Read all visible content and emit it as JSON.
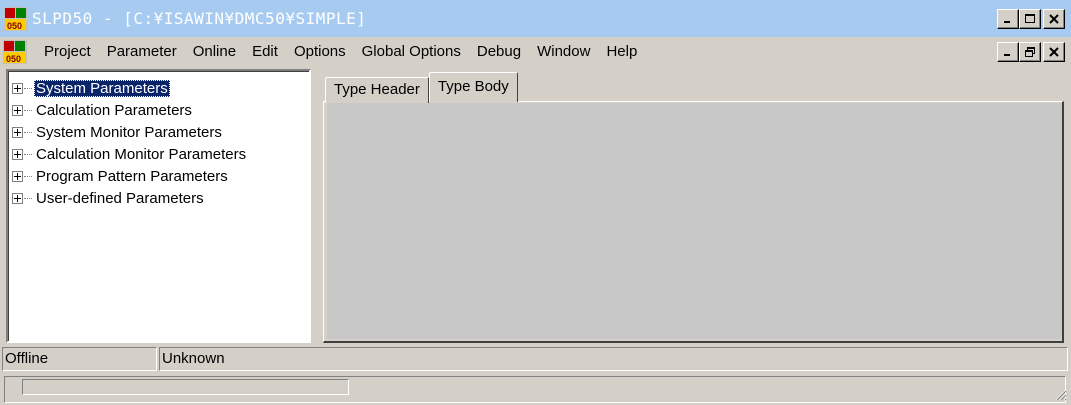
{
  "window": {
    "title": "SLPD50 - [C:¥ISAWIN¥DMC50¥SIMPLE]",
    "app_icon": "slpd50-app-icon",
    "controls": [
      "minimize-icon",
      "maximize-icon",
      "close-icon"
    ]
  },
  "menubar": {
    "doc_icon": "slpd50-doc-icon",
    "items": [
      {
        "label": "Project"
      },
      {
        "label": "Parameter"
      },
      {
        "label": "Online"
      },
      {
        "label": "Edit"
      },
      {
        "label": "Options"
      },
      {
        "label": "Global Options"
      },
      {
        "label": "Debug"
      },
      {
        "label": "Window"
      },
      {
        "label": "Help"
      }
    ],
    "mdi_controls": [
      "minimize-icon",
      "restore-icon",
      "close-icon"
    ]
  },
  "tree": {
    "items": [
      {
        "label": "System Parameters",
        "selected": true
      },
      {
        "label": "Calculation Parameters"
      },
      {
        "label": "System Monitor Parameters"
      },
      {
        "label": "Calculation Monitor Parameters"
      },
      {
        "label": "Program Pattern Parameters"
      },
      {
        "label": "User-defined Parameters"
      }
    ]
  },
  "tabs": [
    {
      "label": "Type Header"
    },
    {
      "label": "Type Body",
      "active": true
    }
  ],
  "statusbar": {
    "connection": "Offline",
    "state": "Unknown"
  },
  "colors": {
    "titlebar": "#a6caf0",
    "face": "#d4d0c8",
    "selection": "#0a246a"
  }
}
